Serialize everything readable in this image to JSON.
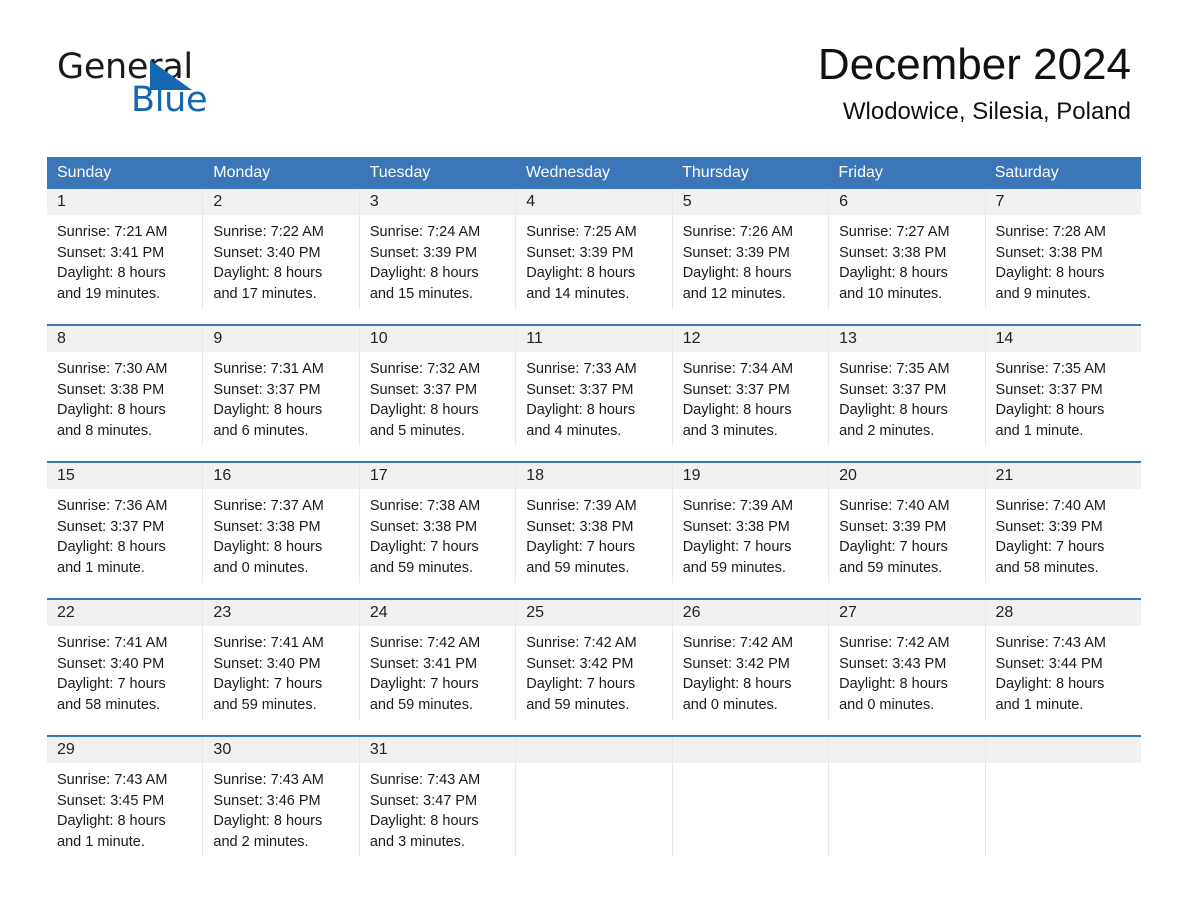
{
  "brand": {
    "name_part1": "General",
    "name_part2": "Blue",
    "accent_color": "#1667b1"
  },
  "header": {
    "title": "December 2024",
    "subtitle": "Wlodowice, Silesia, Poland"
  },
  "theme": {
    "header_blue": "#3a76b8",
    "date_band_gray": "#f1f1f1"
  },
  "weekdays": [
    "Sunday",
    "Monday",
    "Tuesday",
    "Wednesday",
    "Thursday",
    "Friday",
    "Saturday"
  ],
  "weeks": [
    [
      {
        "day": "1",
        "sunrise": "Sunrise: 7:21 AM",
        "sunset": "Sunset: 3:41 PM",
        "daylight_line1": "Daylight: 8 hours",
        "daylight_line2": "and 19 minutes."
      },
      {
        "day": "2",
        "sunrise": "Sunrise: 7:22 AM",
        "sunset": "Sunset: 3:40 PM",
        "daylight_line1": "Daylight: 8 hours",
        "daylight_line2": "and 17 minutes."
      },
      {
        "day": "3",
        "sunrise": "Sunrise: 7:24 AM",
        "sunset": "Sunset: 3:39 PM",
        "daylight_line1": "Daylight: 8 hours",
        "daylight_line2": "and 15 minutes."
      },
      {
        "day": "4",
        "sunrise": "Sunrise: 7:25 AM",
        "sunset": "Sunset: 3:39 PM",
        "daylight_line1": "Daylight: 8 hours",
        "daylight_line2": "and 14 minutes."
      },
      {
        "day": "5",
        "sunrise": "Sunrise: 7:26 AM",
        "sunset": "Sunset: 3:39 PM",
        "daylight_line1": "Daylight: 8 hours",
        "daylight_line2": "and 12 minutes."
      },
      {
        "day": "6",
        "sunrise": "Sunrise: 7:27 AM",
        "sunset": "Sunset: 3:38 PM",
        "daylight_line1": "Daylight: 8 hours",
        "daylight_line2": "and 10 minutes."
      },
      {
        "day": "7",
        "sunrise": "Sunrise: 7:28 AM",
        "sunset": "Sunset: 3:38 PM",
        "daylight_line1": "Daylight: 8 hours",
        "daylight_line2": "and 9 minutes."
      }
    ],
    [
      {
        "day": "8",
        "sunrise": "Sunrise: 7:30 AM",
        "sunset": "Sunset: 3:38 PM",
        "daylight_line1": "Daylight: 8 hours",
        "daylight_line2": "and 8 minutes."
      },
      {
        "day": "9",
        "sunrise": "Sunrise: 7:31 AM",
        "sunset": "Sunset: 3:37 PM",
        "daylight_line1": "Daylight: 8 hours",
        "daylight_line2": "and 6 minutes."
      },
      {
        "day": "10",
        "sunrise": "Sunrise: 7:32 AM",
        "sunset": "Sunset: 3:37 PM",
        "daylight_line1": "Daylight: 8 hours",
        "daylight_line2": "and 5 minutes."
      },
      {
        "day": "11",
        "sunrise": "Sunrise: 7:33 AM",
        "sunset": "Sunset: 3:37 PM",
        "daylight_line1": "Daylight: 8 hours",
        "daylight_line2": "and 4 minutes."
      },
      {
        "day": "12",
        "sunrise": "Sunrise: 7:34 AM",
        "sunset": "Sunset: 3:37 PM",
        "daylight_line1": "Daylight: 8 hours",
        "daylight_line2": "and 3 minutes."
      },
      {
        "day": "13",
        "sunrise": "Sunrise: 7:35 AM",
        "sunset": "Sunset: 3:37 PM",
        "daylight_line1": "Daylight: 8 hours",
        "daylight_line2": "and 2 minutes."
      },
      {
        "day": "14",
        "sunrise": "Sunrise: 7:35 AM",
        "sunset": "Sunset: 3:37 PM",
        "daylight_line1": "Daylight: 8 hours",
        "daylight_line2": "and 1 minute."
      }
    ],
    [
      {
        "day": "15",
        "sunrise": "Sunrise: 7:36 AM",
        "sunset": "Sunset: 3:37 PM",
        "daylight_line1": "Daylight: 8 hours",
        "daylight_line2": "and 1 minute."
      },
      {
        "day": "16",
        "sunrise": "Sunrise: 7:37 AM",
        "sunset": "Sunset: 3:38 PM",
        "daylight_line1": "Daylight: 8 hours",
        "daylight_line2": "and 0 minutes."
      },
      {
        "day": "17",
        "sunrise": "Sunrise: 7:38 AM",
        "sunset": "Sunset: 3:38 PM",
        "daylight_line1": "Daylight: 7 hours",
        "daylight_line2": "and 59 minutes."
      },
      {
        "day": "18",
        "sunrise": "Sunrise: 7:39 AM",
        "sunset": "Sunset: 3:38 PM",
        "daylight_line1": "Daylight: 7 hours",
        "daylight_line2": "and 59 minutes."
      },
      {
        "day": "19",
        "sunrise": "Sunrise: 7:39 AM",
        "sunset": "Sunset: 3:38 PM",
        "daylight_line1": "Daylight: 7 hours",
        "daylight_line2": "and 59 minutes."
      },
      {
        "day": "20",
        "sunrise": "Sunrise: 7:40 AM",
        "sunset": "Sunset: 3:39 PM",
        "daylight_line1": "Daylight: 7 hours",
        "daylight_line2": "and 59 minutes."
      },
      {
        "day": "21",
        "sunrise": "Sunrise: 7:40 AM",
        "sunset": "Sunset: 3:39 PM",
        "daylight_line1": "Daylight: 7 hours",
        "daylight_line2": "and 58 minutes."
      }
    ],
    [
      {
        "day": "22",
        "sunrise": "Sunrise: 7:41 AM",
        "sunset": "Sunset: 3:40 PM",
        "daylight_line1": "Daylight: 7 hours",
        "daylight_line2": "and 58 minutes."
      },
      {
        "day": "23",
        "sunrise": "Sunrise: 7:41 AM",
        "sunset": "Sunset: 3:40 PM",
        "daylight_line1": "Daylight: 7 hours",
        "daylight_line2": "and 59 minutes."
      },
      {
        "day": "24",
        "sunrise": "Sunrise: 7:42 AM",
        "sunset": "Sunset: 3:41 PM",
        "daylight_line1": "Daylight: 7 hours",
        "daylight_line2": "and 59 minutes."
      },
      {
        "day": "25",
        "sunrise": "Sunrise: 7:42 AM",
        "sunset": "Sunset: 3:42 PM",
        "daylight_line1": "Daylight: 7 hours",
        "daylight_line2": "and 59 minutes."
      },
      {
        "day": "26",
        "sunrise": "Sunrise: 7:42 AM",
        "sunset": "Sunset: 3:42 PM",
        "daylight_line1": "Daylight: 8 hours",
        "daylight_line2": "and 0 minutes."
      },
      {
        "day": "27",
        "sunrise": "Sunrise: 7:42 AM",
        "sunset": "Sunset: 3:43 PM",
        "daylight_line1": "Daylight: 8 hours",
        "daylight_line2": "and 0 minutes."
      },
      {
        "day": "28",
        "sunrise": "Sunrise: 7:43 AM",
        "sunset": "Sunset: 3:44 PM",
        "daylight_line1": "Daylight: 8 hours",
        "daylight_line2": "and 1 minute."
      }
    ],
    [
      {
        "day": "29",
        "sunrise": "Sunrise: 7:43 AM",
        "sunset": "Sunset: 3:45 PM",
        "daylight_line1": "Daylight: 8 hours",
        "daylight_line2": "and 1 minute."
      },
      {
        "day": "30",
        "sunrise": "Sunrise: 7:43 AM",
        "sunset": "Sunset: 3:46 PM",
        "daylight_line1": "Daylight: 8 hours",
        "daylight_line2": "and 2 minutes."
      },
      {
        "day": "31",
        "sunrise": "Sunrise: 7:43 AM",
        "sunset": "Sunset: 3:47 PM",
        "daylight_line1": "Daylight: 8 hours",
        "daylight_line2": "and 3 minutes."
      },
      {
        "day": "",
        "sunrise": "",
        "sunset": "",
        "daylight_line1": "",
        "daylight_line2": ""
      },
      {
        "day": "",
        "sunrise": "",
        "sunset": "",
        "daylight_line1": "",
        "daylight_line2": ""
      },
      {
        "day": "",
        "sunrise": "",
        "sunset": "",
        "daylight_line1": "",
        "daylight_line2": ""
      },
      {
        "day": "",
        "sunrise": "",
        "sunset": "",
        "daylight_line1": "",
        "daylight_line2": ""
      }
    ]
  ]
}
